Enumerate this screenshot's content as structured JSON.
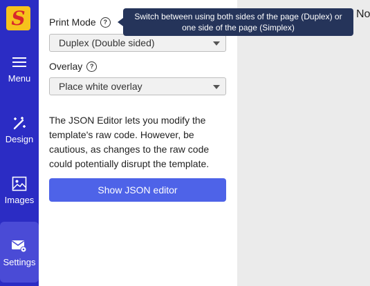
{
  "sidebar": {
    "logo_letter": "S",
    "items": [
      {
        "label": "Menu",
        "icon": "hamburger-icon"
      },
      {
        "label": "Design",
        "icon": "magic-wand-icon"
      },
      {
        "label": "Images",
        "icon": "image-icon"
      },
      {
        "label": "Settings",
        "icon": "mail-gear-icon"
      }
    ],
    "active": "Settings"
  },
  "panel": {
    "print_mode": {
      "label": "Print Mode",
      "value": "Duplex (Double sided)"
    },
    "overlay": {
      "label": "Overlay",
      "value": "Place white overlay"
    },
    "description": "The JSON Editor lets you modify the template's raw code. However, be cautious, as changes to the raw code could potentially disrupt the template.",
    "json_button_label": "Show JSON editor"
  },
  "tooltip": {
    "text": "Switch between using both sides of the page (Duplex) or one side of the page (Simplex)"
  },
  "canvas": {
    "partial_text": "No"
  },
  "colors": {
    "sidebar": "#2b2cc4",
    "sidebar_active": "#4a4bd6",
    "button": "#4e63e8",
    "tooltip": "#25345a",
    "logo": "#f6c21c"
  }
}
